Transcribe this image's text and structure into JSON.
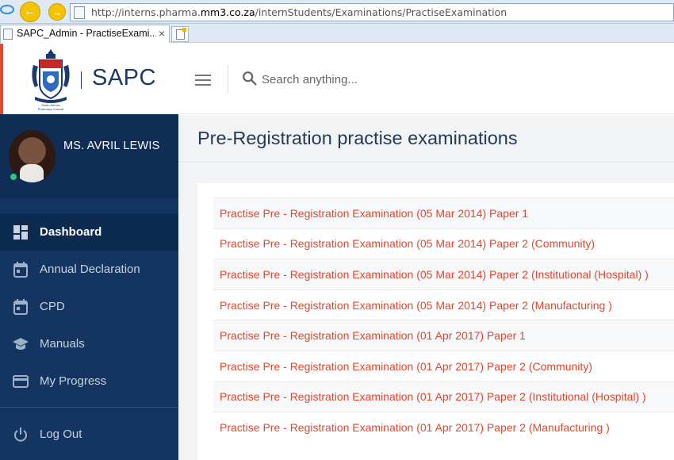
{
  "browser": {
    "url_prefix": "http://interns.pharma.",
    "url_domain": "mm3.co.za",
    "url_path": "/internStudents/Examinations/PractiseExamination",
    "tab_title": "SAPC_Admin - PractiseExami...",
    "tab_close": "×"
  },
  "header": {
    "brand_name": "SAPC",
    "crest_caption_1": "South African",
    "crest_caption_2": "Pharmacy Council",
    "search_placeholder": "Search anything..."
  },
  "profile": {
    "name": "MS. AVRIL LEWIS",
    "status": "online"
  },
  "sidebar": {
    "items": [
      {
        "label": "Dashboard",
        "icon": "dashboard-icon",
        "active": true
      },
      {
        "label": "Annual Declaration",
        "icon": "calendar-icon",
        "active": false
      },
      {
        "label": "CPD",
        "icon": "calendar-icon",
        "active": false
      },
      {
        "label": "Manuals",
        "icon": "school-icon",
        "active": false
      },
      {
        "label": "My Progress",
        "icon": "credit-card-icon",
        "active": false
      },
      {
        "label": "Log Out",
        "icon": "power-icon",
        "active": false
      }
    ]
  },
  "main": {
    "title": "Pre-Registration practise examinations",
    "exams": [
      "Practise Pre - Registration Examination (05 Mar 2014) Paper 1",
      "Practise Pre - Registration Examination (05 Mar 2014) Paper 2 (Community)",
      "Practise Pre - Registration Examination (05 Mar 2014) Paper 2 (Institutional (Hospital) )",
      "Practise Pre - Registration Examination (05 Mar 2014) Paper 2 (Manufacturing )",
      "Practise Pre - Registration Examination (01 Apr 2017) Paper 1",
      "Practise Pre - Registration Examination (01 Apr 2017) Paper 2 (Community)",
      "Practise Pre - Registration Examination (01 Apr 2017) Paper 2 (Institutional (Hospital) )",
      "Practise Pre - Registration Examination (01 Apr 2017) Paper 2 (Manufacturing )"
    ]
  },
  "colors": {
    "sidebar": "#143561",
    "accent_link": "#e5452b",
    "brand": "#1b3a6b"
  }
}
